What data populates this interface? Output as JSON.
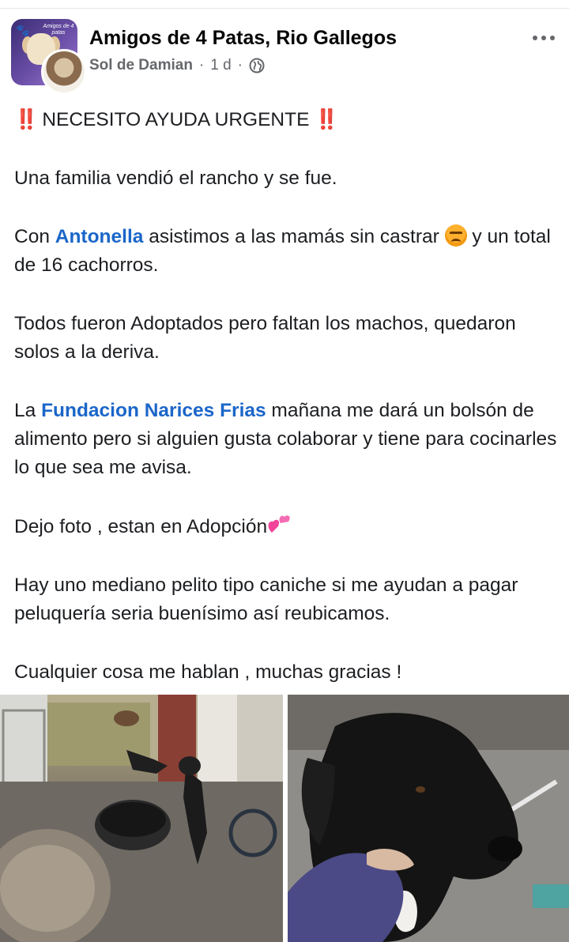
{
  "header": {
    "group_name": "Amigos de 4 Patas, Rio Gallegos",
    "author": "Sol de Damian",
    "time": "1 d",
    "separator": "·",
    "group_logo_text": "Amigos de 4 patas",
    "privacy_icon": "globe-icon",
    "menu_icon": "more-options-icon"
  },
  "post": {
    "headline": "NECESITO AYUDA URGENTE",
    "headline_marks": "‼️",
    "p1": "Una familia vendió el rancho y se fue.",
    "p2_a": "Con ",
    "p2_mention": "Antonella",
    "p2_b": " asistimos a las mamás sin castrar ",
    "p2_c": " y un total de 16 cachorros.",
    "p3": "Todos fueron Adoptados pero faltan los machos, quedaron solos a la deriva.",
    "p4_a": "La ",
    "p4_mention": "Fundacion Narices Frias",
    "p4_b": " mañana me dará un bolsón de alimento pero si alguien gusta colaborar y tiene para cocinarles lo que sea me avisa.",
    "p5": "Dejo foto , estan en Adopción",
    "p6": "Hay uno mediano pelito tipo caniche si me ayudan a pagar peluquería seria buenísimo así reubicamos.",
    "p7": "Cualquier cosa me hablan , muchas gracias !"
  },
  "colors": {
    "mention": "#1b66c9",
    "meta_text": "#65676b",
    "body_text": "#1c1e21"
  },
  "photos": [
    {
      "name": "photo-yard-dogs"
    },
    {
      "name": "photo-black-puppy"
    }
  ]
}
